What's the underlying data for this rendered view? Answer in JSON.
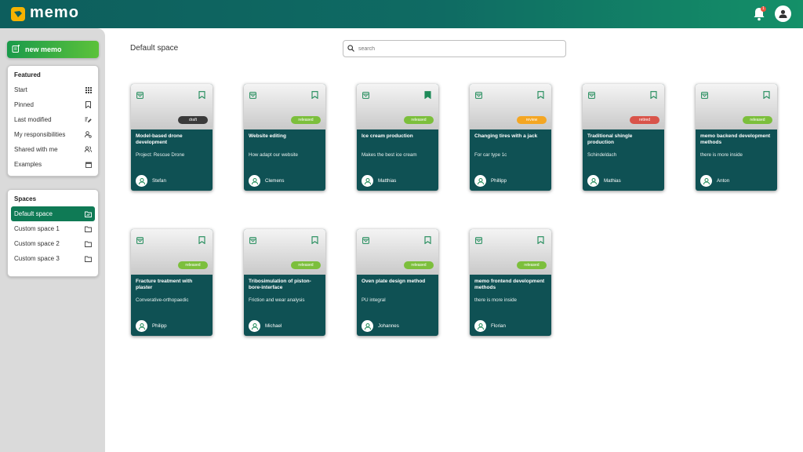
{
  "app": {
    "name": "memo",
    "notification_count": "1"
  },
  "sidebar": {
    "new_memo_label": "new memo",
    "featured": {
      "title": "Featured",
      "items": [
        {
          "label": "Start",
          "icon": "grid-icon"
        },
        {
          "label": "Pinned",
          "icon": "bookmark-icon"
        },
        {
          "label": "Last modified",
          "icon": "edit-icon"
        },
        {
          "label": "My responsibilities",
          "icon": "user-responsibility-icon"
        },
        {
          "label": "Shared with me",
          "icon": "users-icon"
        },
        {
          "label": "Examples",
          "icon": "calendar-icon"
        }
      ]
    },
    "spaces": {
      "title": "Spaces",
      "items": [
        {
          "label": "Default space",
          "icon": "folder-open-icon",
          "active": true
        },
        {
          "label": "Custom space 1",
          "icon": "folder-icon"
        },
        {
          "label": "Custom space 2",
          "icon": "folder-icon"
        },
        {
          "label": "Custom space 3",
          "icon": "folder-icon"
        }
      ]
    }
  },
  "main": {
    "title": "Default space",
    "search": {
      "placeholder": "search",
      "value": ""
    },
    "status_colors": {
      "draft": "#3a3a3a",
      "released": "#7cbf3c",
      "review": "#f4a623",
      "retired": "#d9544a"
    },
    "cards": [
      {
        "title": "Model-based drone development",
        "subtitle": "Project: Rescue Drone",
        "owner": "Stefan",
        "status": "draft",
        "bookmarked": false
      },
      {
        "title": "Website editing",
        "subtitle": "How adapt our website",
        "owner": "Clemens",
        "status": "released",
        "bookmarked": false
      },
      {
        "title": "Ice cream production",
        "subtitle": "Makes the best ice cream",
        "owner": "Matthias",
        "status": "released",
        "bookmarked": true
      },
      {
        "title": "Changing tires with a jack",
        "subtitle": "For car type 1c",
        "owner": "Phillipp",
        "status": "review",
        "bookmarked": false
      },
      {
        "title": "Traditional shingle production",
        "subtitle": "Schindeldach",
        "owner": "Mathias",
        "status": "retired",
        "bookmarked": false
      },
      {
        "title": "memo backend development methods",
        "subtitle": "there is more inside",
        "owner": "Anton",
        "status": "released",
        "bookmarked": false
      },
      {
        "title": "Fracture treatment with plaster",
        "subtitle": "Converative-orthopaedic",
        "owner": "Philipp",
        "status": "released",
        "bookmarked": false
      },
      {
        "title": "Tribosimulation of piston-bore-interface",
        "subtitle": "Friction and wear analysis",
        "owner": "Michael",
        "status": "released",
        "bookmarked": false
      },
      {
        "title": "Oven plate design method",
        "subtitle": "PU integral",
        "owner": "Johannes",
        "status": "released",
        "bookmarked": false
      },
      {
        "title": "memo frontend development methods",
        "subtitle": "there is more inside",
        "owner": "Florian",
        "status": "released",
        "bookmarked": false
      }
    ]
  }
}
